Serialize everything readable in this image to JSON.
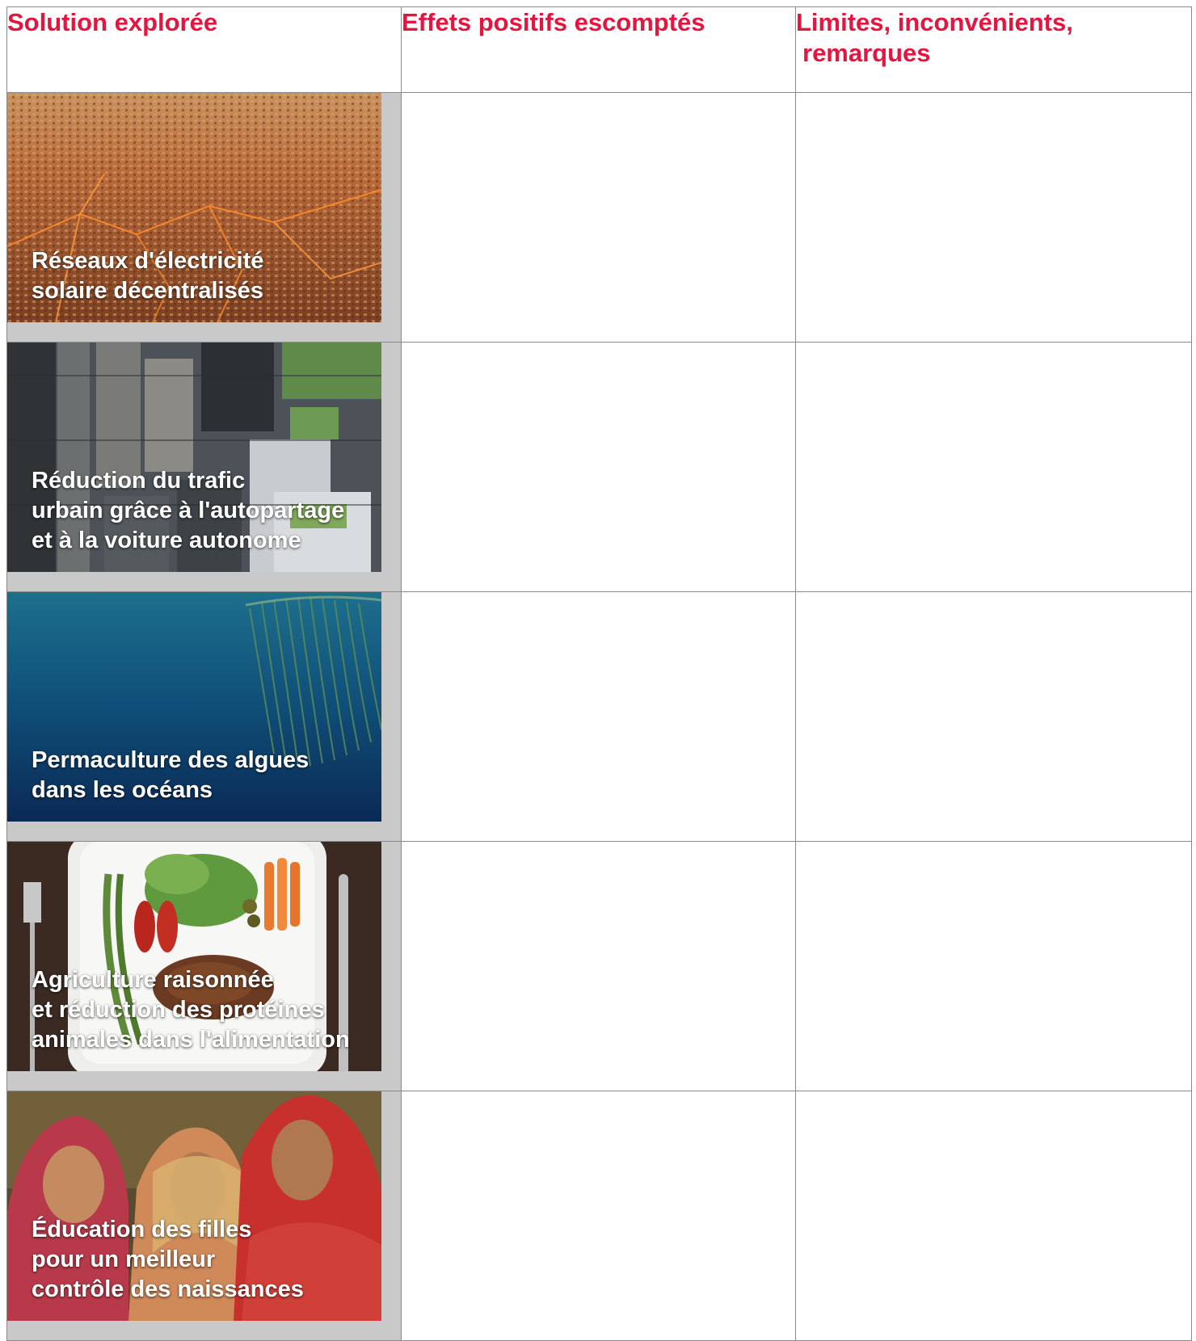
{
  "theme": {
    "heading_color": "#e2163f"
  },
  "table": {
    "headers": [
      {
        "line1": "Solution explorée",
        "line2": ""
      },
      {
        "line1": "Effets positifs escomptés",
        "line2": ""
      },
      {
        "line1": "Limites, inconvénients,",
        "line2": "remarques"
      }
    ],
    "rows": [
      {
        "caption": [
          "Réseaux d'électricité",
          "solaire décentralisés"
        ]
      },
      {
        "caption": [
          "Réduction du trafic",
          "urbain grâce à l'autopartage",
          "et à la voiture autonome"
        ]
      },
      {
        "caption": [
          "Permaculture des algues",
          "dans les océans"
        ]
      },
      {
        "caption": [
          "Agriculture raisonnée",
          "et réduction des protéines",
          "animales dans l'alimentation"
        ]
      },
      {
        "caption": [
          "Éducation des filles",
          "pour un meilleur",
          "contrôle des naissances"
        ]
      }
    ]
  }
}
